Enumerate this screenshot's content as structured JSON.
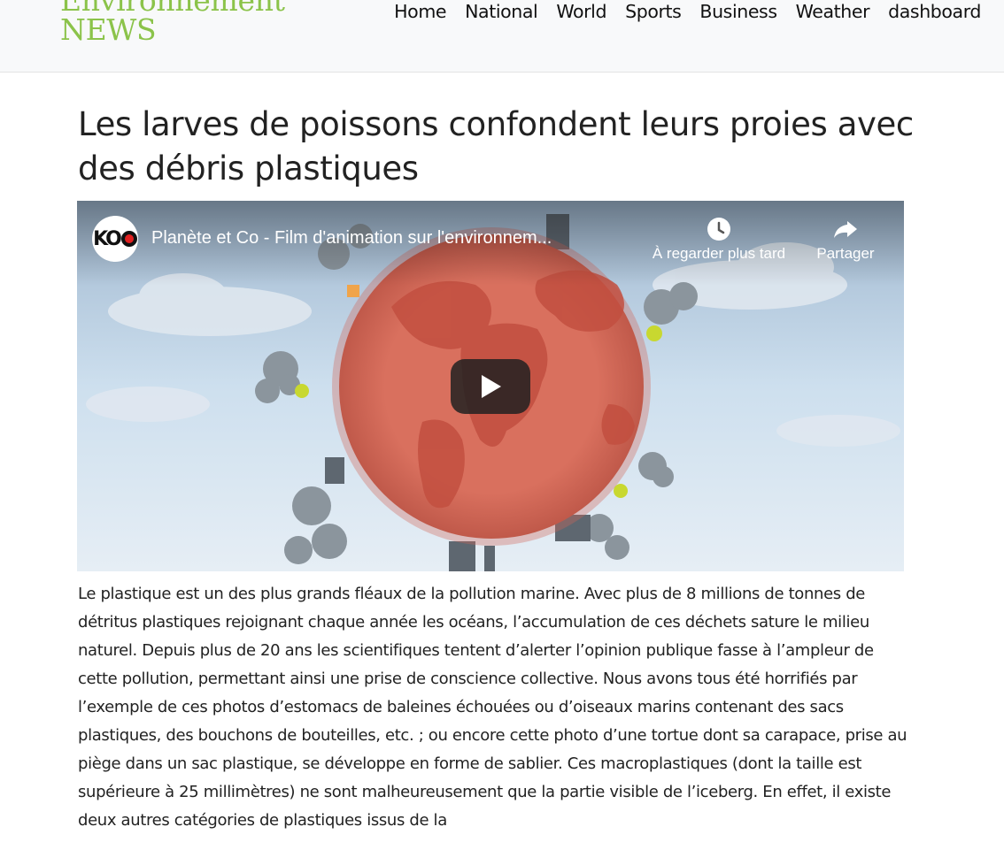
{
  "site": {
    "brand_line1": "Environnement",
    "brand_line2": "NEWS",
    "brand_color": "#8bc34a"
  },
  "nav": {
    "items": [
      "Home",
      "National",
      "World",
      "Sports",
      "Business",
      "Weather",
      "dashboard"
    ]
  },
  "article": {
    "title": "Les larves de poissons confondent leurs proies avec des débris plastiques",
    "body": "Le plastique est un des plus grands fléaux de la pollution marine. Avec plus de 8 millions de tonnes de détritus plastiques rejoignant chaque année les océans, l’accumulation de ces déchets sature le milieu naturel. Depuis plus de 20 ans les scientifiques tentent d’alerter l’opinion publique fasse à l’ampleur de cette pollution, permettant ainsi une prise de conscience collective. Nous avons tous été horrifiés par l’exemple de ces photos d’estomacs de baleines échouées ou d’oiseaux marins contenant des sacs plastiques, des bouchons de bouteilles, etc. ; ou encore cette photo d’une tortue dont sa carapace, prise au piège dans un sac plastique, se développe en forme de sablier. Ces macroplastiques (dont la taille est supérieure à 25 millimètres) ne sont malheureusement que la partie visible de l’iceberg. En effet, il existe deux autres catégories de plastiques issus de la"
  },
  "video": {
    "channel_logo_text": "KO",
    "title": "Planète et Co - Film d'animation sur l'environnem...",
    "watch_later_label": "À regarder plus tard",
    "share_label": "Partager",
    "icons": [
      "clock-icon",
      "share-arrow-icon",
      "play-icon"
    ]
  }
}
